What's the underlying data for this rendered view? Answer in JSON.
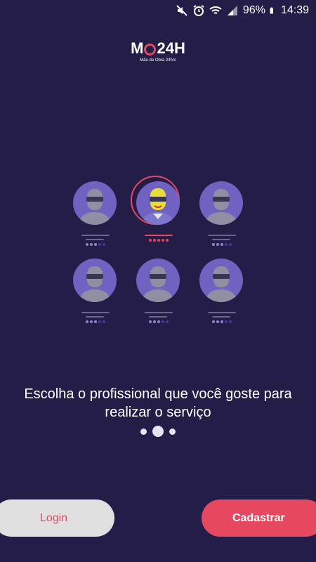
{
  "status_bar": {
    "battery_percent": "96%",
    "time": "14:39",
    "icons": [
      "mute-icon",
      "alarm-icon",
      "wifi-icon",
      "signal-icon",
      "battery-icon"
    ]
  },
  "brand": {
    "logo_left": "M",
    "logo_right": "24H",
    "tagline": "Mão de Obra 24hrs",
    "accent_color": "#e5485f",
    "background_color": "#241d48"
  },
  "illustration": {
    "professionals": [
      {
        "selected": false,
        "rating": 3
      },
      {
        "selected": true,
        "rating": 5
      },
      {
        "selected": false,
        "rating": 3
      },
      {
        "selected": false,
        "rating": 3
      },
      {
        "selected": false,
        "rating": 3
      },
      {
        "selected": false,
        "rating": 3
      }
    ]
  },
  "onboarding": {
    "headline": "Escolha o profissional que você goste para realizar o serviço",
    "page_count": 3,
    "current_page": 2
  },
  "actions": {
    "login_label": "Login",
    "register_label": "Cadastrar"
  }
}
